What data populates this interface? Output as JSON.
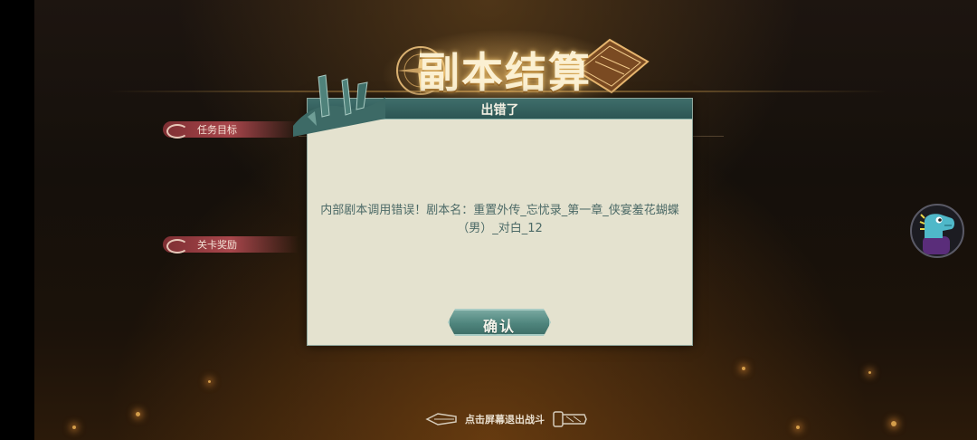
{
  "banner": {
    "title": "副本结算"
  },
  "side_panel": {
    "objective_label": "任务目标",
    "reward_label": "关卡奖励"
  },
  "dialog": {
    "title": "出错了",
    "message": "内部剧本调用错误！剧本名：重置外传_忘忧录_第一章_侠宴羞花蝴蝶（男）_对白_12",
    "confirm_label": "确认"
  },
  "footer": {
    "exit_hint": "点击屏幕退出战斗"
  },
  "icons": {
    "banner_left": "compass-icon",
    "banner_right": "book-icon",
    "exit_left": "arrow-left-icon",
    "exit_right": "scroll-icon",
    "assistant": "dinosaur-avatar-icon"
  },
  "colors": {
    "dialog_bg": "#e4e2cf",
    "dialog_header": "#2c5553",
    "accent_red": "#a8464b",
    "gold": "#fbf0d2"
  }
}
